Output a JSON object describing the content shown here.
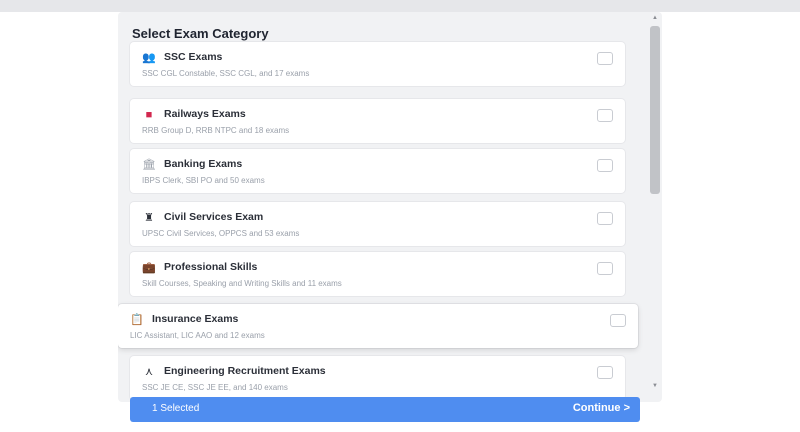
{
  "modal": {
    "title": "Select Exam Category"
  },
  "categories": [
    {
      "icon": "people-icon",
      "glyph": "👥",
      "title": "SSC Exams",
      "subtitle": "SSC CGL Constable, SSC CGL, and 17 exams",
      "icon_color": "#1f2430"
    },
    {
      "icon": "book-icon",
      "glyph": "■",
      "title": "Railways Exams",
      "subtitle": "RRB Group D, RRB NTPC and 18 exams",
      "icon_color": "#d2274e"
    },
    {
      "icon": "bank-icon",
      "glyph": "🏛",
      "title": "Banking Exams",
      "subtitle": "IBPS Clerk, SBI PO and 50 exams",
      "icon_color": "#9aa0aa"
    },
    {
      "icon": "trophy-icon",
      "glyph": "♜",
      "title": "Civil Services Exam",
      "subtitle": "UPSC Civil Services, OPPCS and 53 exams",
      "icon_color": "#2b2f38"
    },
    {
      "icon": "briefcase-icon",
      "glyph": "💼",
      "title": "Professional Skills",
      "subtitle": "Skill Courses, Speaking and Writing Skills and 11 exams",
      "icon_color": "#d4a017"
    },
    {
      "icon": "clipboard-icon",
      "glyph": "📋",
      "title": "Insurance Exams",
      "subtitle": "LIC Assistant, LIC AAO and 12 exams",
      "icon_color": "#6b7280"
    },
    {
      "icon": "engineer-icon",
      "glyph": "⋏",
      "title": "Engineering Recruitment Exams",
      "subtitle": "SSC JE CE, SSC JE EE, and 140 exams",
      "icon_color": "#2b2f38"
    }
  ],
  "footer": {
    "selected_text": "1 Selected",
    "continue_label": "Continue  >"
  }
}
